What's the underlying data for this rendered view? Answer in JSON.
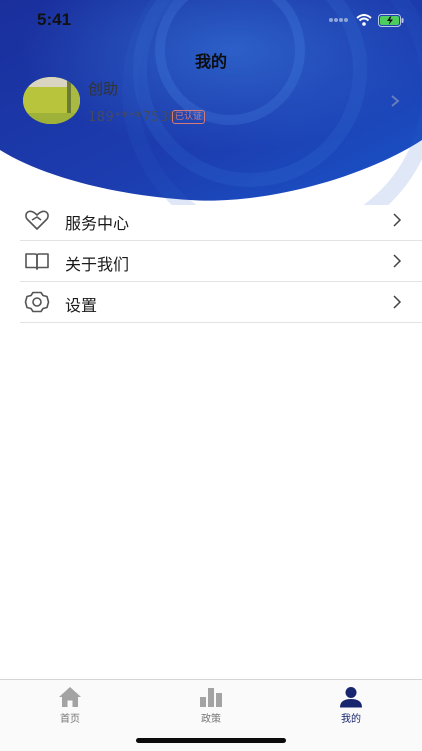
{
  "status_bar": {
    "time": "5:41"
  },
  "header": {
    "title": "我的"
  },
  "profile": {
    "name": "创助",
    "phone": "189****7538",
    "badge": "已认证"
  },
  "menu": [
    {
      "label": "服务中心",
      "icon": "heart-icon"
    },
    {
      "label": "关于我们",
      "icon": "book-icon"
    },
    {
      "label": "设置",
      "icon": "gear-icon"
    }
  ],
  "tabbar": [
    {
      "label": "首页",
      "icon": "home-icon",
      "active": false
    },
    {
      "label": "政策",
      "icon": "bar-chart-icon",
      "active": false
    },
    {
      "label": "我的",
      "icon": "person-icon",
      "active": true
    }
  ],
  "colors": {
    "header_blue": "#1f3aa6",
    "header_dark": "#14268a",
    "tab_active": "#17256e"
  }
}
